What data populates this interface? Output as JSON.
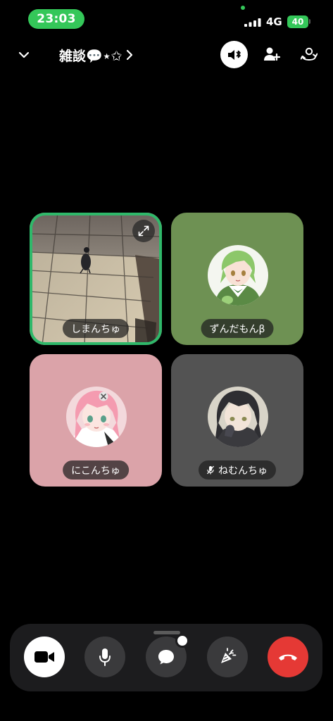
{
  "status_bar": {
    "time": "23:03",
    "network": "4G",
    "battery": "40"
  },
  "header": {
    "room_title": "雑談💬⋆✩"
  },
  "participants": [
    {
      "name": "しまんちゅ",
      "speaking": true,
      "video_on": true
    },
    {
      "name": "ずんだもんβ",
      "speaking": false,
      "video_on": false
    },
    {
      "name": "にこんちゅ",
      "speaking": false,
      "video_on": false
    },
    {
      "name": "ねむんちゅ",
      "speaking": false,
      "video_on": false,
      "muted": true
    }
  ],
  "colors": {
    "accent_green": "#34c759",
    "speaking_ring": "#2fb86a",
    "end_call_red": "#e53935",
    "tile_green": "#6e9153",
    "tile_pink": "#dba3a9",
    "tile_gray": "#535353"
  },
  "icons": {
    "header": [
      "chevron-down-icon",
      "chevron-right-icon",
      "speaker-bluetooth-icon",
      "add-person-icon",
      "switch-camera-icon"
    ],
    "controls": [
      "video-camera-icon",
      "microphone-icon",
      "chat-bubble-icon",
      "effects-icon",
      "end-call-icon"
    ]
  }
}
